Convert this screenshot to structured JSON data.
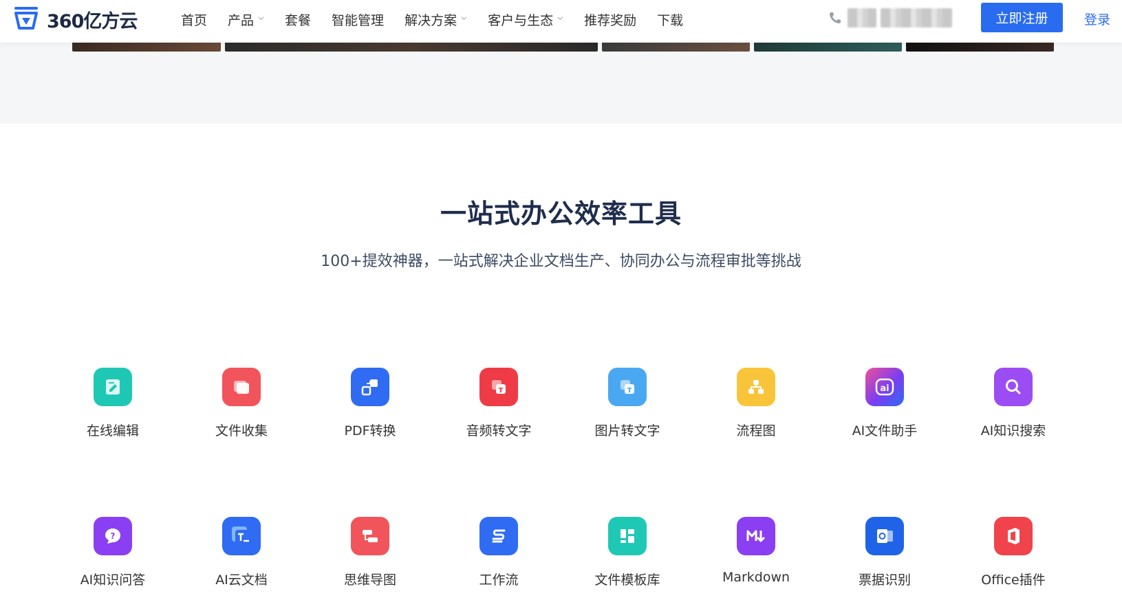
{
  "header": {
    "logo_text": "360亿方云",
    "nav": [
      {
        "label": "首页",
        "has_dropdown": false
      },
      {
        "label": "产品",
        "has_dropdown": true
      },
      {
        "label": "套餐",
        "has_dropdown": false
      },
      {
        "label": "智能管理",
        "has_dropdown": false
      },
      {
        "label": "解决方案",
        "has_dropdown": true
      },
      {
        "label": "客户与生态",
        "has_dropdown": true
      },
      {
        "label": "推荐奖励",
        "has_dropdown": false
      },
      {
        "label": "下载",
        "has_dropdown": false
      }
    ],
    "phone_icon": "phone-icon",
    "register_label": "立即注册",
    "login_label": "登录"
  },
  "section": {
    "title": "一站式办公效率工具",
    "subtitle": "100+提效神器，一站式解决企业文档生产、协同办公与流程审批等挑战"
  },
  "tools": [
    {
      "label": "在线编辑",
      "icon": "edit-doc-icon",
      "color": "#1fc8b4"
    },
    {
      "label": "文件收集",
      "icon": "folder-collect-icon",
      "color": "#f2545b"
    },
    {
      "label": "PDF转换",
      "icon": "pdf-convert-icon",
      "color": "#2f6bf3"
    },
    {
      "label": "音频转文字",
      "icon": "audio-to-text-icon",
      "color": "#ef3b45"
    },
    {
      "label": "图片转文字",
      "icon": "image-to-text-icon",
      "color": "#4aa8f3"
    },
    {
      "label": "流程图",
      "icon": "flowchart-icon",
      "color": "#f8c53a"
    },
    {
      "label": "AI文件助手",
      "icon": "ai-assistant-icon",
      "color": "#8a3ef0"
    },
    {
      "label": "AI知识搜索",
      "icon": "ai-search-icon",
      "color": "#9b4df3"
    },
    {
      "label": "AI知识问答",
      "icon": "ai-qa-icon",
      "color": "#8b3ff2"
    },
    {
      "label": "AI云文档",
      "icon": "ai-cloud-doc-icon",
      "color": "#2f6bf3"
    },
    {
      "label": "思维导图",
      "icon": "mindmap-icon",
      "color": "#f2545b"
    },
    {
      "label": "工作流",
      "icon": "workflow-icon",
      "color": "#2f6bf3"
    },
    {
      "label": "文件模板库",
      "icon": "template-library-icon",
      "color": "#1fc8b4"
    },
    {
      "label": "Markdown",
      "icon": "markdown-icon",
      "color": "#8b3ff2"
    },
    {
      "label": "票据识别",
      "icon": "invoice-recognition-icon",
      "color": "#1f63e8"
    },
    {
      "label": "Office插件",
      "icon": "office-plugin-icon",
      "color": "#f0434b"
    }
  ]
}
